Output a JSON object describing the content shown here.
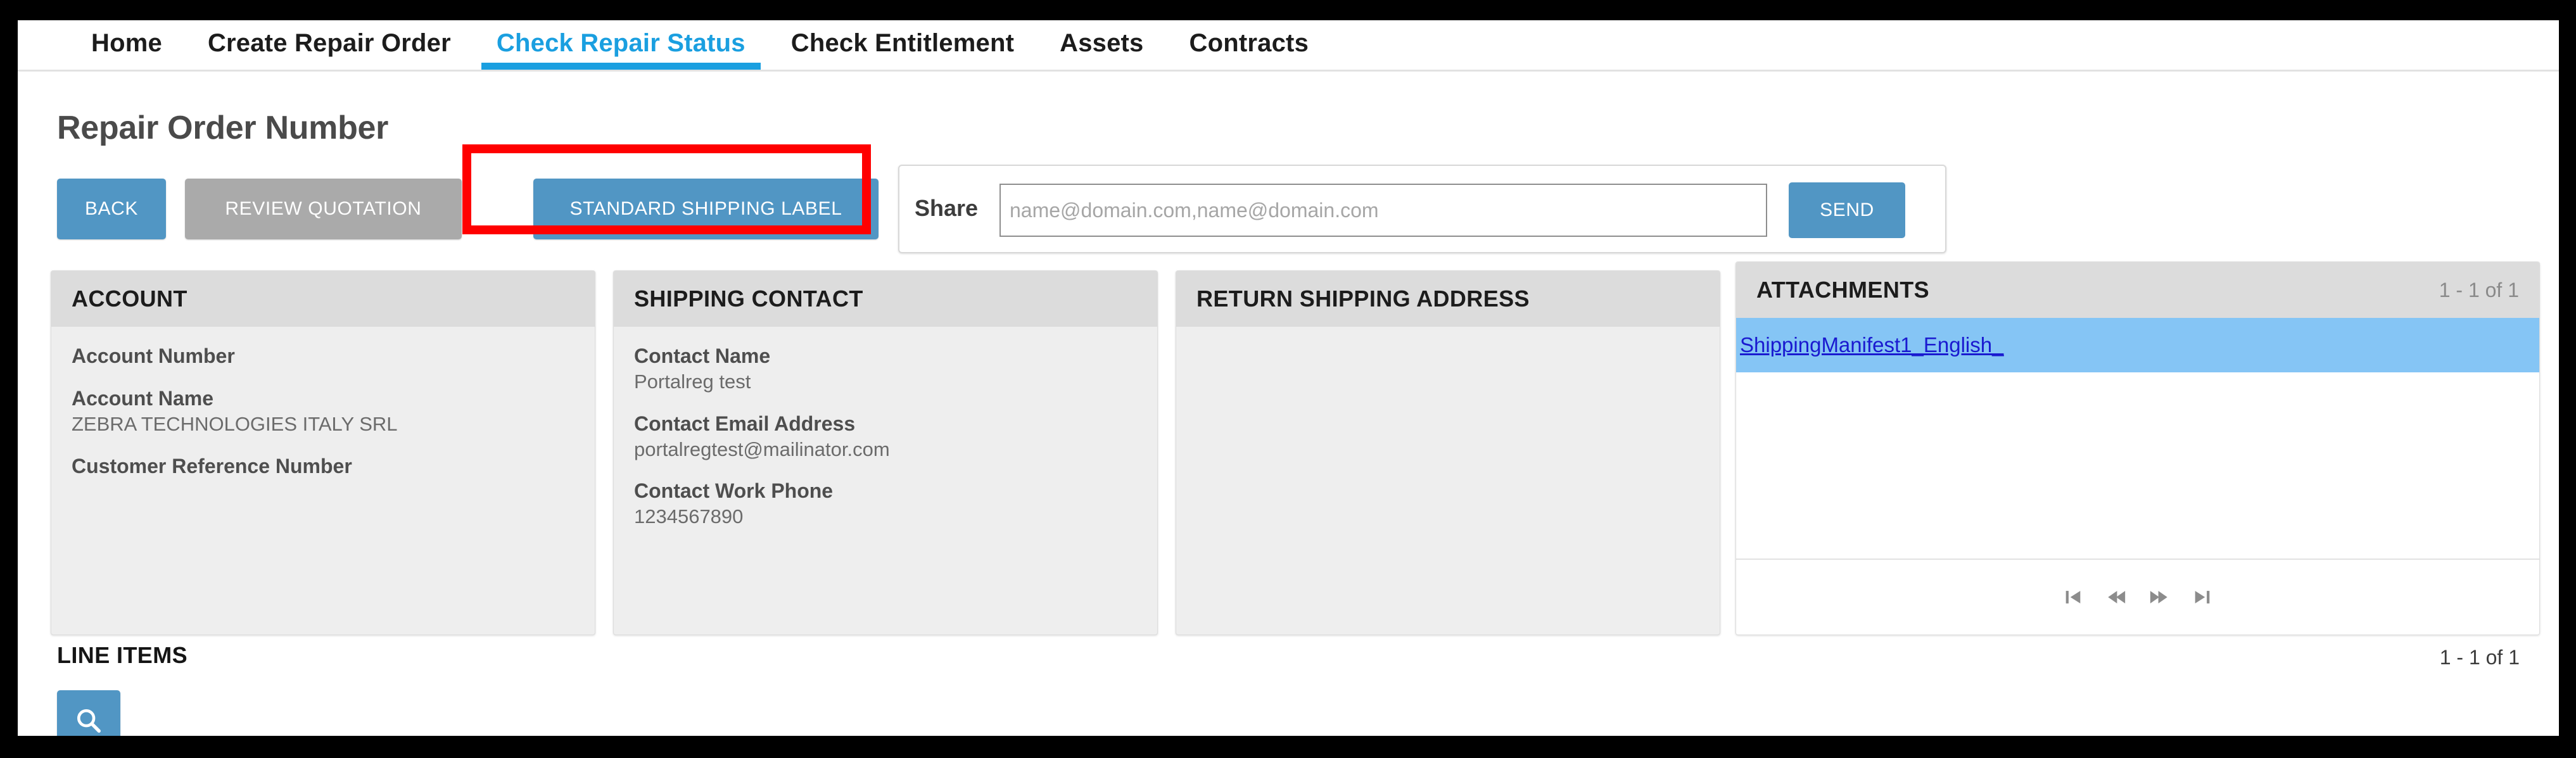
{
  "nav": {
    "items": [
      {
        "label": "Home",
        "active": false
      },
      {
        "label": "Create Repair Order",
        "active": false
      },
      {
        "label": "Check Repair Status",
        "active": true
      },
      {
        "label": "Check Entitlement",
        "active": false
      },
      {
        "label": "Assets",
        "active": false
      },
      {
        "label": "Contracts",
        "active": false
      }
    ]
  },
  "header": {
    "title": "Repair Order Number"
  },
  "toolbar": {
    "back_label": "BACK",
    "review_quotation_label": "REVIEW QUOTATION",
    "standard_shipping_label": "STANDARD SHIPPING LABEL",
    "send_label": "SEND"
  },
  "share": {
    "label": "Share",
    "placeholder": "name@domain.com,name@domain.com",
    "value": ""
  },
  "panels": {
    "account": {
      "title": "ACCOUNT",
      "fields": [
        {
          "label": "Account Number",
          "value": ""
        },
        {
          "label": "Account Name",
          "value": "ZEBRA TECHNOLOGIES ITALY SRL"
        },
        {
          "label": "Customer Reference Number",
          "value": ""
        }
      ]
    },
    "shipping_contact": {
      "title": "SHIPPING CONTACT",
      "fields": [
        {
          "label": "Contact Name",
          "value": "Portalreg test"
        },
        {
          "label": "Contact Email Address",
          "value": "portalregtest@mailinator.com"
        },
        {
          "label": "Contact Work Phone",
          "value": "1234567890"
        }
      ]
    },
    "return_shipping_address": {
      "title": "RETURN SHIPPING ADDRESS",
      "fields": []
    },
    "attachments": {
      "title": "ATTACHMENTS",
      "count": "1 - 1 of 1",
      "items": [
        {
          "name": "ShippingManifest1_English_",
          "selected": true
        }
      ],
      "pager": {
        "first_icon": "first-page-icon",
        "prev_icon": "previous-page-icon",
        "next_icon": "next-page-icon",
        "last_icon": "last-page-icon"
      }
    }
  },
  "line_items": {
    "title": "LINE ITEMS",
    "count": "1 - 1 of 1",
    "search_icon": "search-icon"
  },
  "colors": {
    "accent_blue": "#5196c4",
    "tab_active_blue": "#1a9fe0",
    "disabled_gray": "#aaaaaa",
    "panel_header_gray": "#dcdcdc",
    "panel_body_gray": "#eeeeee",
    "row_selected_blue": "#85c5f5",
    "link_blue": "#1a1ad0",
    "highlight_red": "#ff0000"
  },
  "annotation": {
    "highlight_target": "standard-shipping-label-button"
  }
}
